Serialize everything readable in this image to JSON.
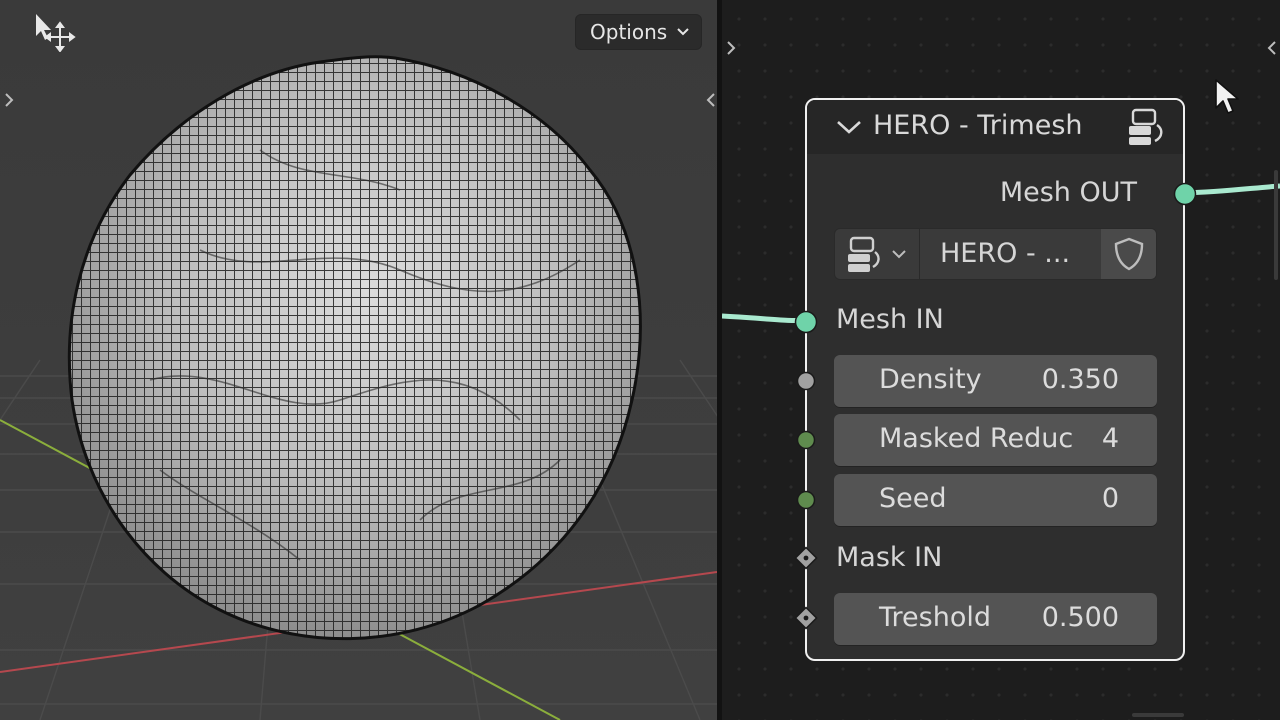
{
  "viewport": {
    "options_label": "Options",
    "tool_icon": "move-select-icon",
    "grid_colors": {
      "x_axis": "#b5484e",
      "y_axis": "#8bae3c",
      "grid": "#4a4a4a"
    },
    "object": "wireframe-sphere"
  },
  "node_editor": {
    "node": {
      "title": "HERO - Trimesh",
      "output_label": "Mesh OUT",
      "datablock_name": "HERO - ...",
      "mesh_input_label": "Mesh IN",
      "fields": [
        {
          "label": "Density",
          "value": "0.350"
        },
        {
          "label": "Masked Reduc",
          "value": "4"
        },
        {
          "label": "Seed",
          "value": "0"
        }
      ],
      "mask_input_label": "Mask IN",
      "threshold": {
        "label": "Treshold",
        "value": "0.500"
      }
    },
    "colors": {
      "geometry_socket": "#6fd3a9",
      "float_socket": "#a1a1a1",
      "int_socket": "#5f8b4e",
      "node_border": "#f0f0f0"
    }
  }
}
